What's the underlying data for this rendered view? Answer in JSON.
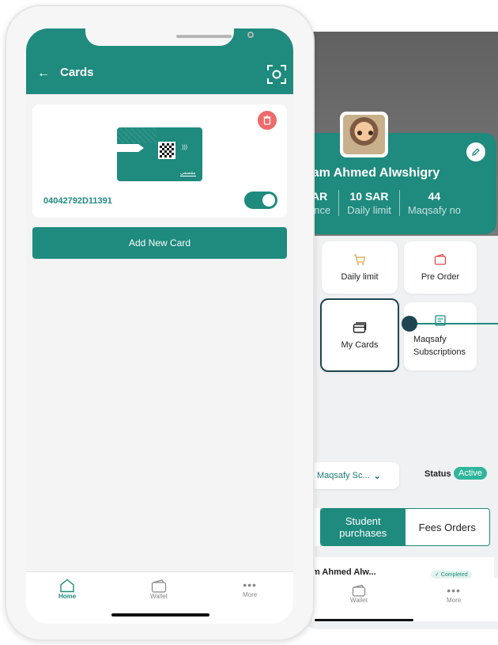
{
  "front": {
    "header_title": "Cards",
    "card_number": "04042792D11391",
    "card_brand": "مقصفي",
    "card_active": true,
    "add_button": "Add New Card",
    "nav": [
      {
        "label": "Home",
        "icon": "home-icon",
        "active": true
      },
      {
        "label": "Wallet",
        "icon": "wallet-icon",
        "active": false
      },
      {
        "label": "More",
        "icon": "more-icon",
        "active": false
      }
    ]
  },
  "back": {
    "profile_name": "ham Ahmed Alwshigry",
    "stats": [
      {
        "value": "AR",
        "label": "ance"
      },
      {
        "value": "10 SAR",
        "label": "Daily limit"
      },
      {
        "value": "44",
        "label": "Maqsafy no"
      }
    ],
    "tiles": {
      "daily_limit": "Daily limit",
      "pre_order": "Pre Order",
      "my_cards": "My Cards",
      "subscriptions_line1": "Maqsafy",
      "subscriptions_line2": "Subscriptions"
    },
    "filter_value": "Maqsafy Sc...",
    "status_label": "Status",
    "status_value": "Active",
    "tabs": {
      "student_purchases_1": "Student",
      "student_purchases_2": "purchases",
      "fees_orders": "Fees Orders"
    },
    "order_name": "m Ahmed Alw...",
    "order_status": "✓ Completed",
    "nav": {
      "wallet": "Wallet",
      "more": "More"
    }
  },
  "colors": {
    "primary": "#1f8a7e",
    "dark_accent": "#1d4651",
    "danger": "#ef6a6a",
    "status": "#2fb59b"
  }
}
